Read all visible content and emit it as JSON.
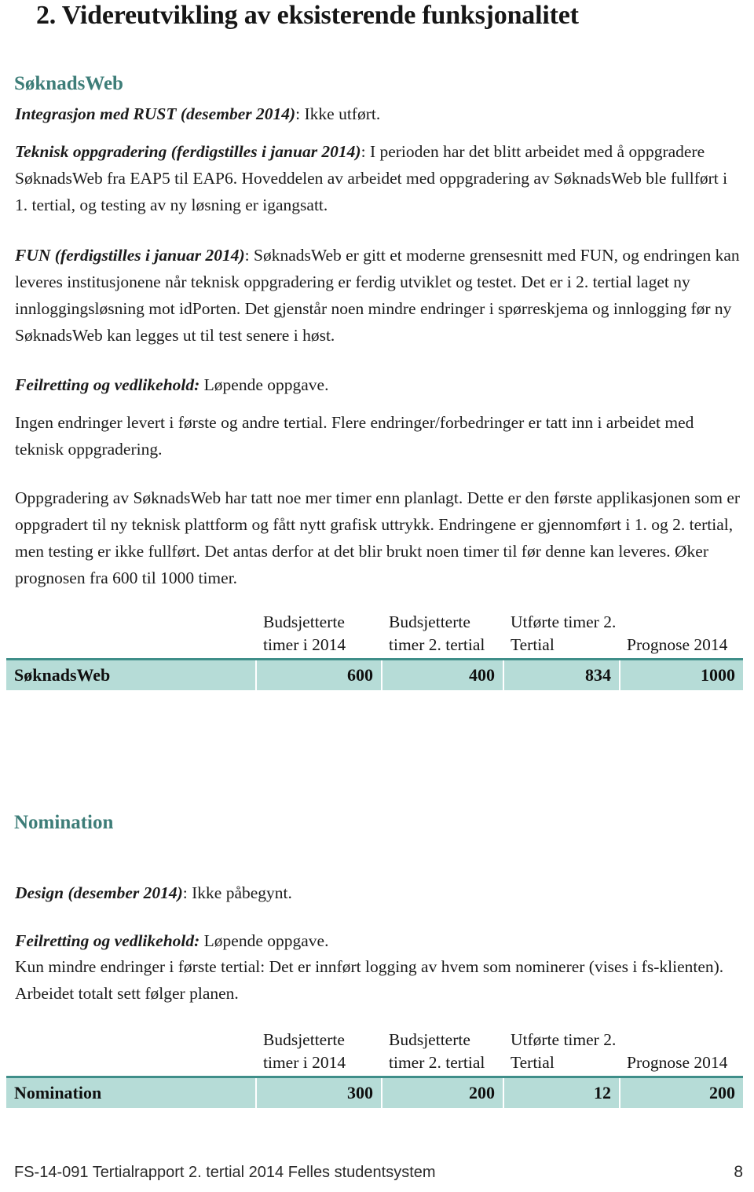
{
  "document": {
    "title": "2. Videreutvikling av eksisterende funksjonalitet",
    "accent_color": "#3d7d78",
    "table_band_color": "#b6dcd7",
    "table_rule_color": "#3f8e89"
  },
  "sections": [
    {
      "heading": "SøknadsWeb",
      "paragraphs": {
        "integrasjon_lead": "Integrasjon med RUST (desember 2014)",
        "integrasjon_body": ": Ikke utført.",
        "teknisk_lead": "Teknisk oppgradering (ferdigstilles i januar 2014)",
        "teknisk_body": ": I perioden har det blitt arbeidet med å oppgradere SøknadsWeb fra EAP5 til EAP6. Hoveddelen av arbeidet med oppgradering av SøknadsWeb ble fullført i 1. tertial, og testing av ny løsning er igangsatt.",
        "fun_lead": "FUN (ferdigstilles i januar 2014)",
        "fun_body": ": SøknadsWeb er gitt et moderne grensesnitt med FUN, og endringen kan leveres institusjonene når teknisk oppgradering er ferdig utviklet og testet. Det er i 2. tertial laget ny innloggingsløsning mot idPorten. Det gjenstår noen mindre endringer i spørreskjema og innlogging før ny SøknadsWeb kan legges ut til test senere i høst.",
        "feilretting_lead": "Feilretting og vedlikehold:",
        "feilretting_body": " Løpende oppgave.",
        "ingen_endringer": "Ingen endringer levert i første og andre tertial. Flere endringer/forbedringer er tatt inn i arbeidet med teknisk oppgradering.",
        "oppgradering": "Oppgradering av SøknadsWeb har tatt noe mer timer enn planlagt. Dette er den første applikasjonen som er oppgradert til ny teknisk plattform og fått nytt grafisk uttrykk. Endringene er gjennomført i 1. og 2. tertial, men testing er ikke fullført. Det antas derfor at det blir brukt noen timer til før denne kan leveres. Øker prognosen fra 600 til 1000 timer."
      }
    },
    {
      "heading": "Nomination",
      "paragraphs": {
        "design_lead": "Design (desember 2014)",
        "design_body": ": Ikke påbegynt.",
        "feilretting_lead": "Feilretting og vedlikehold:",
        "feilretting_body": " Løpende oppgave.",
        "kun_mindre": "Kun mindre endringer i første tertial: Det er innført logging av hvem som nominerer (vises i fs-klienten). Arbeidet totalt sett følger planen."
      }
    }
  ],
  "tables": {
    "soknadsweb": {
      "headers": {
        "name": "",
        "budsjetterte_2014": "Budsjetterte timer i 2014",
        "budsjetterte_2tertial": "Budsjetterte timer 2. tertial",
        "utforte": "Utførte timer 2. Tertial",
        "prognose": "Prognose 2014"
      },
      "row": {
        "name": "SøknadsWeb",
        "budsjetterte_2014": "600",
        "budsjetterte_2tertial": "400",
        "utforte": "834",
        "prognose": "1000"
      }
    },
    "nomination": {
      "headers": {
        "name": "",
        "budsjetterte_2014": "Budsjetterte timer i 2014",
        "budsjetterte_2tertial": "Budsjetterte timer 2. tertial",
        "utforte": "Utførte timer 2. Tertial",
        "prognose": "Prognose 2014"
      },
      "row": {
        "name": "Nomination",
        "budsjetterte_2014": "300",
        "budsjetterte_2tertial": "200",
        "utforte": "12",
        "prognose": "200"
      }
    }
  },
  "footer": {
    "text": "FS-14-091 Tertialrapport 2. tertial 2014 Felles studentsystem",
    "page_number": "8"
  }
}
